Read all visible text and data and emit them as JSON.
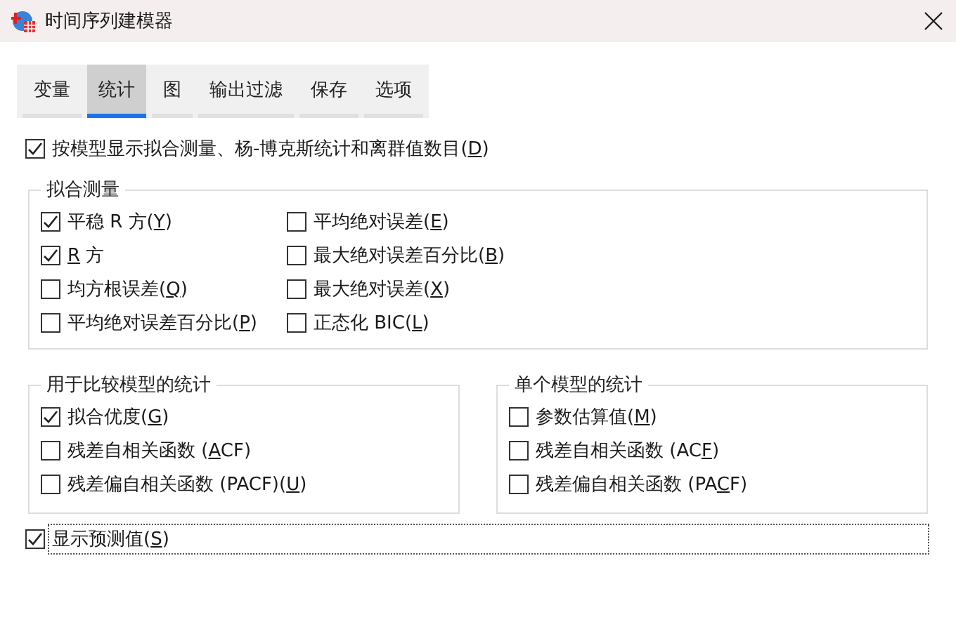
{
  "window": {
    "title": "时间序列建模器"
  },
  "tabs": [
    {
      "label": "变量",
      "selected": false
    },
    {
      "label": "统计",
      "selected": true
    },
    {
      "label": "图",
      "selected": false
    },
    {
      "label": "输出过滤",
      "selected": false
    },
    {
      "label": "保存",
      "selected": false
    },
    {
      "label": "选项",
      "selected": false
    }
  ],
  "display_by_model": {
    "label": {
      "before": "按模型显示拟合测量、杨-博克斯统计和离群值数目(",
      "access_key": "D",
      "after": ")"
    },
    "checked": true
  },
  "fit_measures": {
    "title": "拟合测量",
    "columns": [
      [
        {
          "label": {
            "before": "平稳 R 方(",
            "access_key": "Y",
            "after": ")"
          },
          "checked": true
        },
        {
          "label": {
            "access_key": "R",
            "after": " 方"
          },
          "checked": true
        },
        {
          "label": {
            "before": "均方根误差(",
            "access_key": "Q",
            "after": ")"
          },
          "checked": false
        },
        {
          "label": {
            "before": "平均绝对误差百分比(",
            "access_key": "P",
            "after": ")"
          },
          "checked": false
        }
      ],
      [
        {
          "label": {
            "before": "平均绝对误差(",
            "access_key": "E",
            "after": ")"
          },
          "checked": false
        },
        {
          "label": {
            "before": "最大绝对误差百分比(",
            "access_key": "B",
            "after": ")"
          },
          "checked": false
        },
        {
          "label": {
            "before": "最大绝对误差(",
            "access_key": "X",
            "after": ")"
          },
          "checked": false
        },
        {
          "label": {
            "before": "正态化 BIC(",
            "access_key": "L",
            "after": ")"
          },
          "checked": false
        }
      ]
    ]
  },
  "groups": [
    {
      "title": "用于比较模型的统计",
      "items": [
        {
          "label": {
            "before": "拟合优度(",
            "access_key": "G",
            "after": ")"
          },
          "checked": true
        },
        {
          "label": {
            "before": "残差自相关函数 (",
            "access_key": "A",
            "after": "CF)"
          },
          "checked": false
        },
        {
          "label": {
            "before": "残差偏自相关函数 (PACF)(",
            "access_key": "U",
            "after": ")"
          },
          "checked": false
        }
      ]
    },
    {
      "title": "单个模型的统计",
      "items": [
        {
          "label": {
            "before": "参数估算值(",
            "access_key": "M",
            "after": ")"
          },
          "checked": false
        },
        {
          "label": {
            "before": "残差自相关函数 (AC",
            "access_key": "F",
            "after": ")"
          },
          "checked": false
        },
        {
          "label": {
            "before": "残差偏自相关函数 (PA",
            "access_key": "C",
            "after": "F)"
          },
          "checked": false
        }
      ]
    }
  ],
  "show_forecasts": {
    "label": {
      "before": "显示预测值(",
      "access_key": "S",
      "after": ")"
    },
    "checked": true,
    "focused": true
  }
}
